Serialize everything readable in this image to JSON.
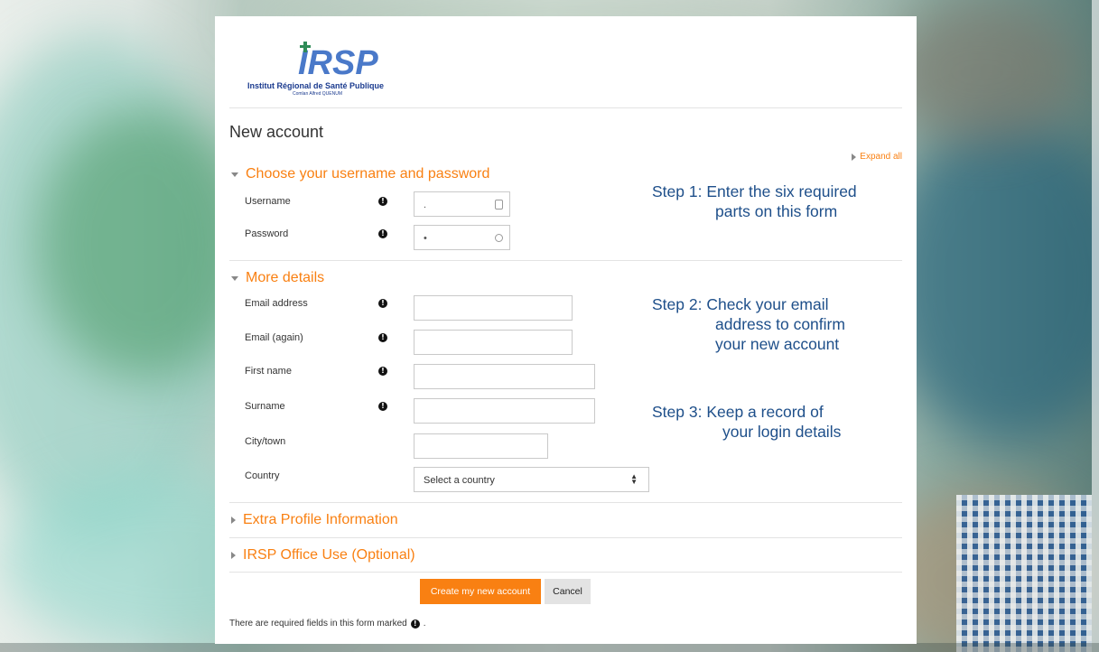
{
  "logo": {
    "name": "Institut Régional de Santé Publique",
    "subtitle": "Comlan Alfred QUENUM",
    "brand_color": "#1b3b8f"
  },
  "page": {
    "title": "New account",
    "expand_all": "Expand all"
  },
  "sections": {
    "credentials": {
      "title": "Choose your username and password"
    },
    "details": {
      "title": "More details"
    },
    "extra": {
      "title": "Extra Profile Information"
    },
    "office": {
      "title": "IRSP Office Use (Optional)"
    }
  },
  "fields": {
    "username": {
      "label": "Username",
      "value": "."
    },
    "password": {
      "label": "Password",
      "value": "•"
    },
    "email": {
      "label": "Email address",
      "value": ""
    },
    "email_again": {
      "label": "Email (again)",
      "value": ""
    },
    "first_name": {
      "label": "First name",
      "value": ""
    },
    "surname": {
      "label": "Surname",
      "value": ""
    },
    "city": {
      "label": "City/town",
      "value": ""
    },
    "country": {
      "label": "Country",
      "value": "Select a country"
    }
  },
  "required_icon": "!",
  "steps": {
    "step1_line1": "Step 1: Enter the six required",
    "step1_line2": "parts on this form",
    "step2_line1": "Step 2: Check your email",
    "step2_line2": "address to confirm",
    "step2_line3": "your new account",
    "step3_line1": "Step 3: Keep a record of",
    "step3_line2": "your login details"
  },
  "buttons": {
    "submit": "Create my new account",
    "cancel": "Cancel"
  },
  "footnote": {
    "text": "There are required fields in this form marked",
    "suffix": "."
  },
  "colors": {
    "accent": "#f98012",
    "step_text": "#1e4f8a"
  }
}
